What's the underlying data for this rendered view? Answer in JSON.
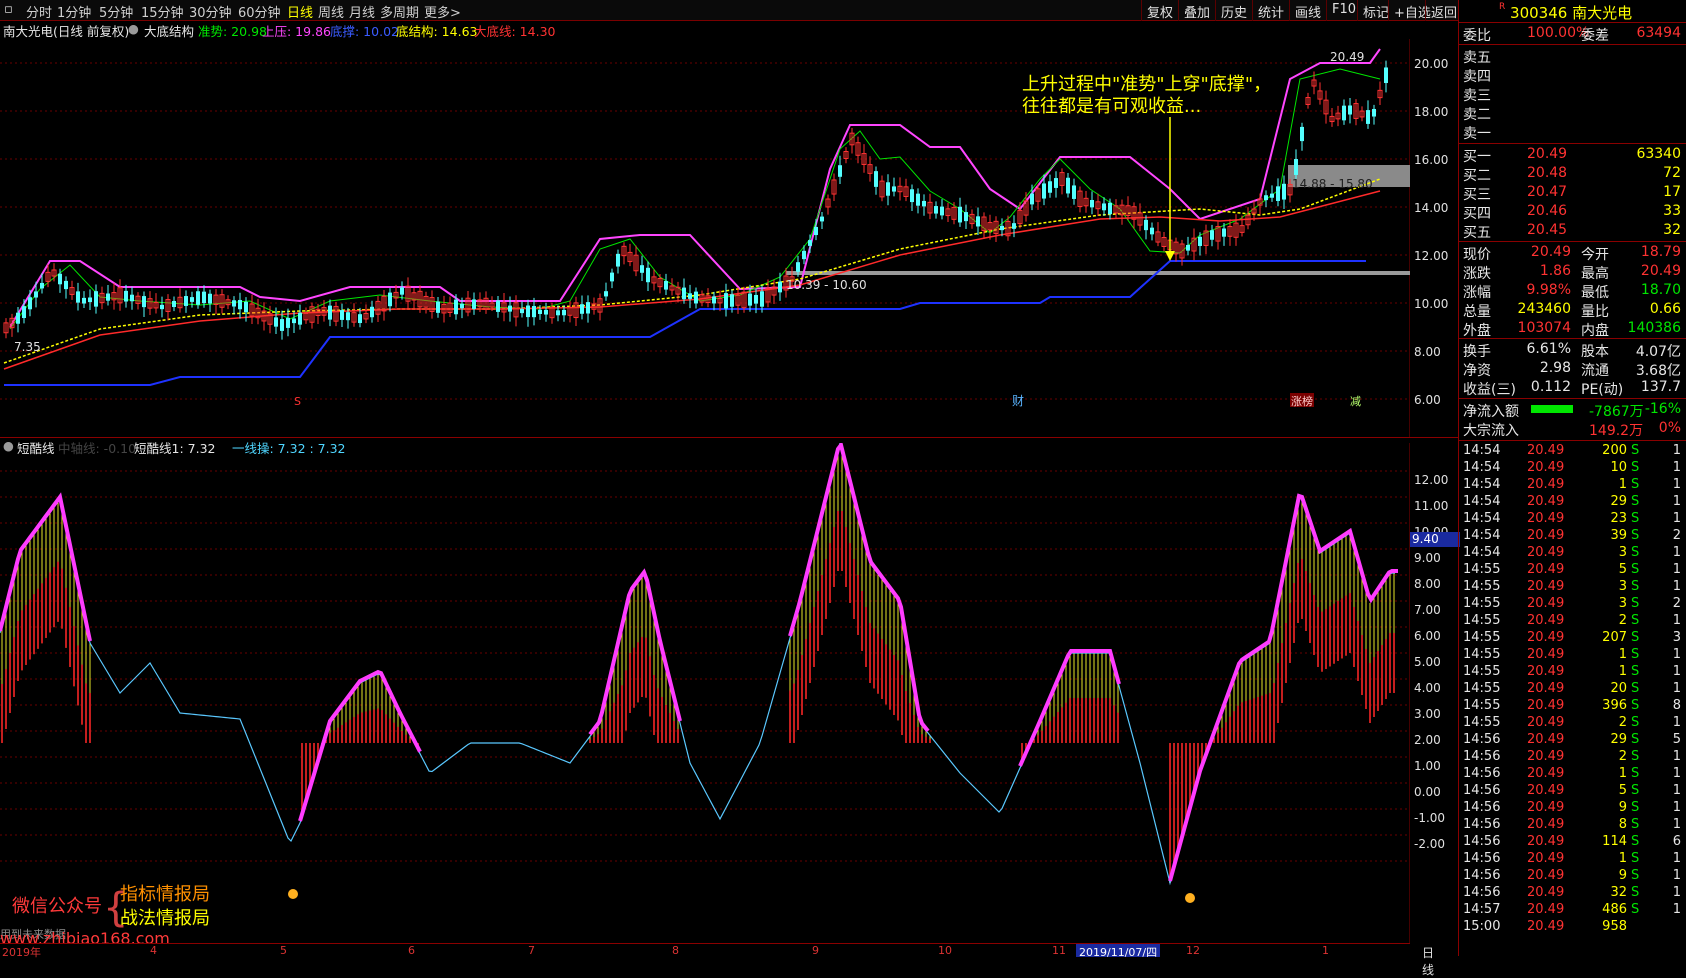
{
  "toolbar": {
    "periods": [
      "分时",
      "1分钟",
      "5分钟",
      "15分钟",
      "30分钟",
      "60分钟",
      "日线",
      "周线",
      "月线",
      "多周期",
      "更多>"
    ],
    "active_period": "日线",
    "actions": [
      "复权",
      "叠加",
      "历史",
      "统计",
      "画线",
      "F10",
      "标记",
      "+自选",
      "返回"
    ]
  },
  "chart_header": {
    "stock_name": "南大光电(日线 前复权)",
    "indicator_name": "大底结构",
    "zhunshi": "准势: 20.98",
    "shangya": "上压: 19.86",
    "dicheng": "底撑: 10.02",
    "dijiegou": "底结构: 14.63",
    "dadixian": "大底线: 14.30"
  },
  "annotation": {
    "line1": "上升过程中\"准势\"上穿\"底撑\"，",
    "line2": "往往都是有可观收益..."
  },
  "price_labels": {
    "high_label": "20.49",
    "low_label": "7.35",
    "band_upper": "14.88 - 15.80",
    "band_lower": "10.39 - 10.60"
  },
  "event_markers": {
    "s_mark": "S",
    "cai": "财",
    "zhangbang": "涨榜",
    "jian": "减"
  },
  "panel2_header": {
    "name": "短酷线",
    "mid_line": "中轴线: -0.10",
    "short_line": "短酷线1: 7.32",
    "one_line": "一线操: 7.32 : 7.32"
  },
  "panel2_cursor_value": "9.40",
  "watermark": {
    "label": "微信公众号",
    "brand1": "指标情报局",
    "brand2": "战法情报局",
    "url": "www.zhibiao168.com",
    "note": "用到未来数据"
  },
  "x_axis": {
    "labels": [
      "2019年",
      "4",
      "5",
      "6",
      "7",
      "8",
      "9",
      "10",
      "11",
      "12",
      "1"
    ],
    "cursor_date": "2019/11/07/四",
    "period_label": "日线"
  },
  "main_y_axis": [
    "20.00",
    "18.00",
    "16.00",
    "14.00",
    "12.00",
    "10.00",
    "8.00",
    "6.00"
  ],
  "sub_y_axis": [
    "12.00",
    "11.00",
    "10.00",
    "9.00",
    "8.00",
    "7.00",
    "6.00",
    "5.00",
    "4.00",
    "3.00",
    "2.00",
    "1.00",
    "0.00",
    "-1.00",
    "-2.00"
  ],
  "quote": {
    "code": "300346",
    "name": "南大光电",
    "weibi_label": "委比",
    "weibi": "100.00%",
    "weicha_label": "委差",
    "weicha": "63494",
    "sells": [
      "卖五",
      "卖四",
      "卖三",
      "卖二",
      "卖一"
    ],
    "buys": [
      {
        "label": "买一",
        "price": "20.49",
        "vol": "63340"
      },
      {
        "label": "买二",
        "price": "20.48",
        "vol": "72"
      },
      {
        "label": "买三",
        "price": "20.47",
        "vol": "17"
      },
      {
        "label": "买四",
        "price": "20.46",
        "vol": "33"
      },
      {
        "label": "买五",
        "price": "20.45",
        "vol": "32"
      }
    ],
    "stats": [
      {
        "l1": "现价",
        "v1": "20.49",
        "l2": "今开",
        "v2": "18.79"
      },
      {
        "l1": "涨跌",
        "v1": "1.86",
        "l2": "最高",
        "v2": "20.49"
      },
      {
        "l1": "涨幅",
        "v1": "9.98%",
        "l2": "最低",
        "v2": "18.70"
      },
      {
        "l1": "总量",
        "v1": "243460",
        "l2": "量比",
        "v2": "0.66"
      },
      {
        "l1": "外盘",
        "v1": "103074",
        "l2": "内盘",
        "v2": "140386"
      }
    ],
    "stats2": [
      {
        "l1": "换手",
        "v1": "6.61%",
        "l2": "股本",
        "v2": "4.07亿"
      },
      {
        "l1": "净资",
        "v1": "2.98",
        "l2": "流通",
        "v2": "3.68亿"
      },
      {
        "l1": "收益(三)",
        "v1": "0.112",
        "l2": "PE(动)",
        "v2": "137.7"
      }
    ],
    "flow": {
      "net_label": "净流入额",
      "net_val": "-7867万",
      "net_pct": "-16%",
      "block_label": "大宗流入",
      "block_val": "149.2万",
      "block_pct": "0%"
    }
  },
  "ticks": [
    [
      "14:54",
      "20.49",
      "200",
      "S",
      "1"
    ],
    [
      "14:54",
      "20.49",
      "10",
      "S",
      "1"
    ],
    [
      "14:54",
      "20.49",
      "1",
      "S",
      "1"
    ],
    [
      "14:54",
      "20.49",
      "29",
      "S",
      "1"
    ],
    [
      "14:54",
      "20.49",
      "23",
      "S",
      "1"
    ],
    [
      "14:54",
      "20.49",
      "39",
      "S",
      "2"
    ],
    [
      "14:54",
      "20.49",
      "3",
      "S",
      "1"
    ],
    [
      "14:55",
      "20.49",
      "5",
      "S",
      "1"
    ],
    [
      "14:55",
      "20.49",
      "3",
      "S",
      "1"
    ],
    [
      "14:55",
      "20.49",
      "3",
      "S",
      "2"
    ],
    [
      "14:55",
      "20.49",
      "2",
      "S",
      "1"
    ],
    [
      "14:55",
      "20.49",
      "207",
      "S",
      "3"
    ],
    [
      "14:55",
      "20.49",
      "1",
      "S",
      "1"
    ],
    [
      "14:55",
      "20.49",
      "1",
      "S",
      "1"
    ],
    [
      "14:55",
      "20.49",
      "20",
      "S",
      "1"
    ],
    [
      "14:55",
      "20.49",
      "396",
      "S",
      "8"
    ],
    [
      "14:55",
      "20.49",
      "2",
      "S",
      "1"
    ],
    [
      "14:56",
      "20.49",
      "29",
      "S",
      "5"
    ],
    [
      "14:56",
      "20.49",
      "2",
      "S",
      "1"
    ],
    [
      "14:56",
      "20.49",
      "1",
      "S",
      "1"
    ],
    [
      "14:56",
      "20.49",
      "5",
      "S",
      "1"
    ],
    [
      "14:56",
      "20.49",
      "9",
      "S",
      "1"
    ],
    [
      "14:56",
      "20.49",
      "8",
      "S",
      "1"
    ],
    [
      "14:56",
      "20.49",
      "114",
      "S",
      "6"
    ],
    [
      "14:56",
      "20.49",
      "1",
      "S",
      "1"
    ],
    [
      "14:56",
      "20.49",
      "9",
      "S",
      "1"
    ],
    [
      "14:56",
      "20.49",
      "32",
      "S",
      "1"
    ],
    [
      "14:57",
      "20.49",
      "486",
      "S",
      "1"
    ],
    [
      "15:00",
      "20.49",
      "958",
      "",
      " "
    ]
  ],
  "colors": {
    "up": "#ff3232",
    "down": "#54ffff",
    "zhunshi": "#00e600",
    "shangya": "#ff46ff",
    "dicheng": "#1e32ff",
    "dadixian": "#ff2a2a",
    "dijiegou": "#ffff00",
    "grid": "#7a0000"
  }
}
